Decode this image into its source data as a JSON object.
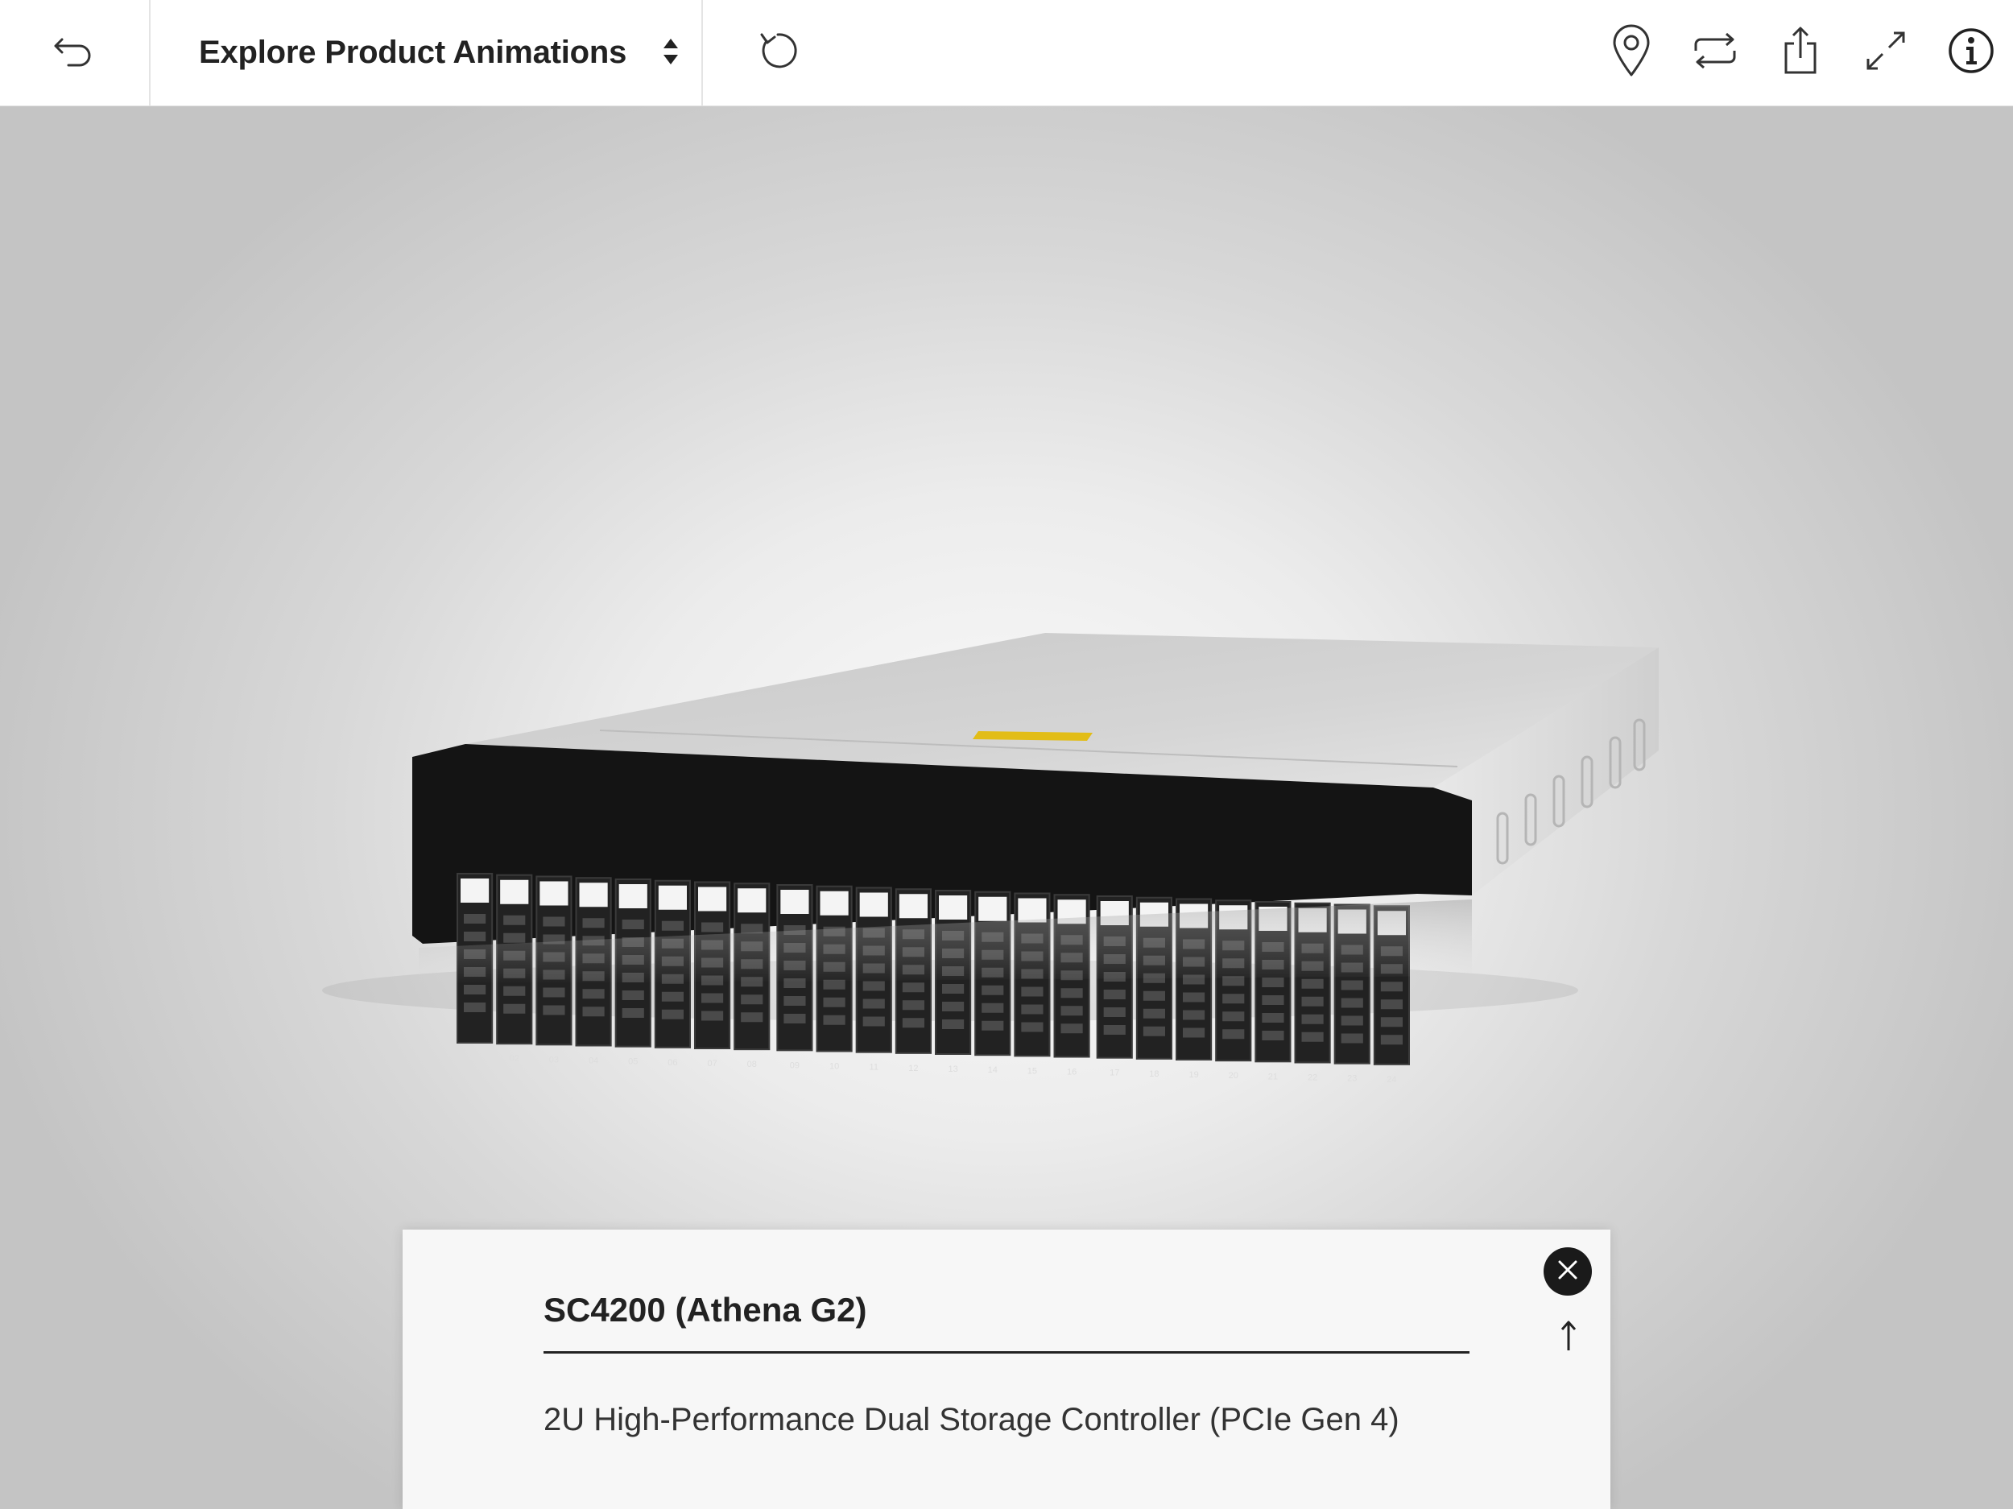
{
  "toolbar": {
    "back_icon": "undo-arrow-icon",
    "title_select_value": "Explore Product Animations",
    "title_select_icon": "sort-arrows-icon",
    "reset_icon": "reset-rotate-icon",
    "right_icons": [
      "location-pin-icon",
      "sync-icon",
      "share-icon",
      "expand-icon",
      "info-icon"
    ]
  },
  "product": {
    "bay_numbers": [
      "01",
      "02",
      "03",
      "04",
      "05",
      "06",
      "07",
      "08",
      "09",
      "10",
      "11",
      "12",
      "13",
      "14",
      "15",
      "16",
      "17",
      "18",
      "19",
      "20",
      "21",
      "22",
      "23",
      "24"
    ]
  },
  "info_card": {
    "title": "SC4200 (Athena G2)",
    "description": "2U High-Performance Dual Storage Controller (PCIe Gen 4)",
    "close_icon": "close-icon",
    "collapse_icon": "arrow-up-icon"
  },
  "colors": {
    "toolbar_bg": "#ffffff",
    "text_dark": "#222222",
    "chassis_black": "#111111",
    "chassis_silver": "#c9c9c9",
    "warning_label": "#e8c21a"
  }
}
